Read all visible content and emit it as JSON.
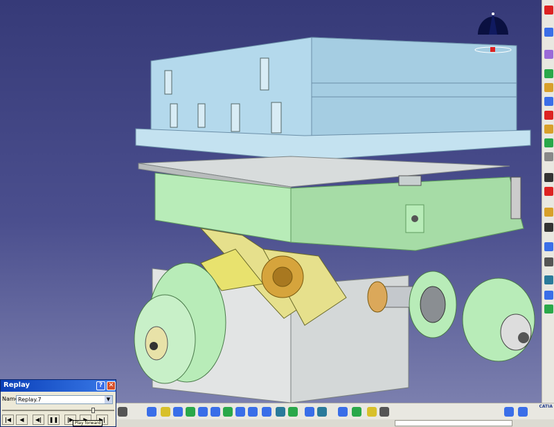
{
  "app": {
    "name": "CATIA",
    "logo_text": "CATIA"
  },
  "viewport": {
    "scene": "3d-machine-assembly"
  },
  "colors": {
    "background_top": "#363a78",
    "background_bottom": "#7b7fae",
    "part_blue": "#b4d9ec",
    "part_green": "#b8ecb8",
    "part_gray": "#d8dcdc",
    "part_yellow": "#e6e08c"
  },
  "replay_dialog": {
    "title": "Replay",
    "help_symbol": "?",
    "close_symbol": "✕",
    "name_label": "Name:",
    "name_value": "Replay.7",
    "slider_position": 0.82,
    "controls": [
      {
        "name": "skip-to-start",
        "symbol": "|◀"
      },
      {
        "name": "step-back",
        "symbol": "◀"
      },
      {
        "name": "play-reverse",
        "symbol": "◀|"
      },
      {
        "name": "pause",
        "symbol": "❚❚"
      },
      {
        "name": "play-forward",
        "symbol": "|▶"
      },
      {
        "name": "step-forward",
        "symbol": "▶"
      },
      {
        "name": "skip-to-end",
        "symbol": "▶|"
      }
    ],
    "tooltip": "Play forward"
  }
}
